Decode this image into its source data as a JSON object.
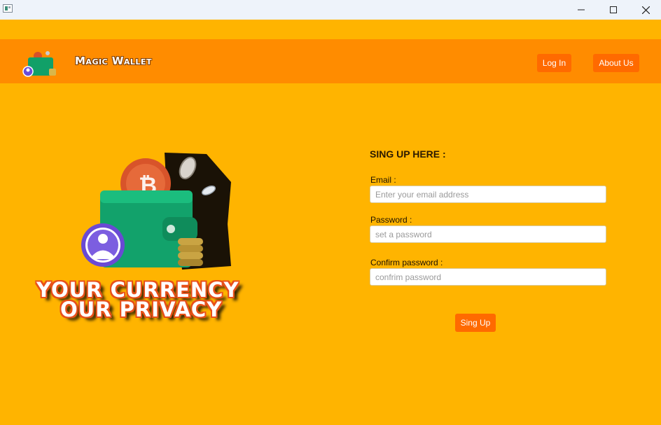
{
  "window": {
    "icons": {
      "app": "app-window-icon",
      "minimize": "minimize-icon",
      "maximize": "maximize-icon",
      "close": "close-icon"
    }
  },
  "header": {
    "brand": "Magic Wallet",
    "logo_icon": "wallet-logo-icon",
    "nav": {
      "login_label": "Log In",
      "about_label": "About Us"
    },
    "colors": {
      "bar": "#ff8c00",
      "button": "#ff6a00"
    }
  },
  "hero": {
    "tagline_line1": "YOUR CURRENCY",
    "tagline_line2": "OUR PRIVACY",
    "image_icon": "wallet-illustration"
  },
  "form": {
    "title": "SING UP HERE :",
    "email": {
      "label": "Email :",
      "placeholder": "Enter your email address",
      "value": ""
    },
    "password": {
      "label": "Password :",
      "placeholder": "set a password",
      "value": ""
    },
    "confirm": {
      "label": "Confirm password :",
      "placeholder": "confrim password",
      "value": ""
    },
    "submit_label": "Sing Up"
  },
  "colors": {
    "background": "#ffb400",
    "accent": "#ff6a00"
  }
}
